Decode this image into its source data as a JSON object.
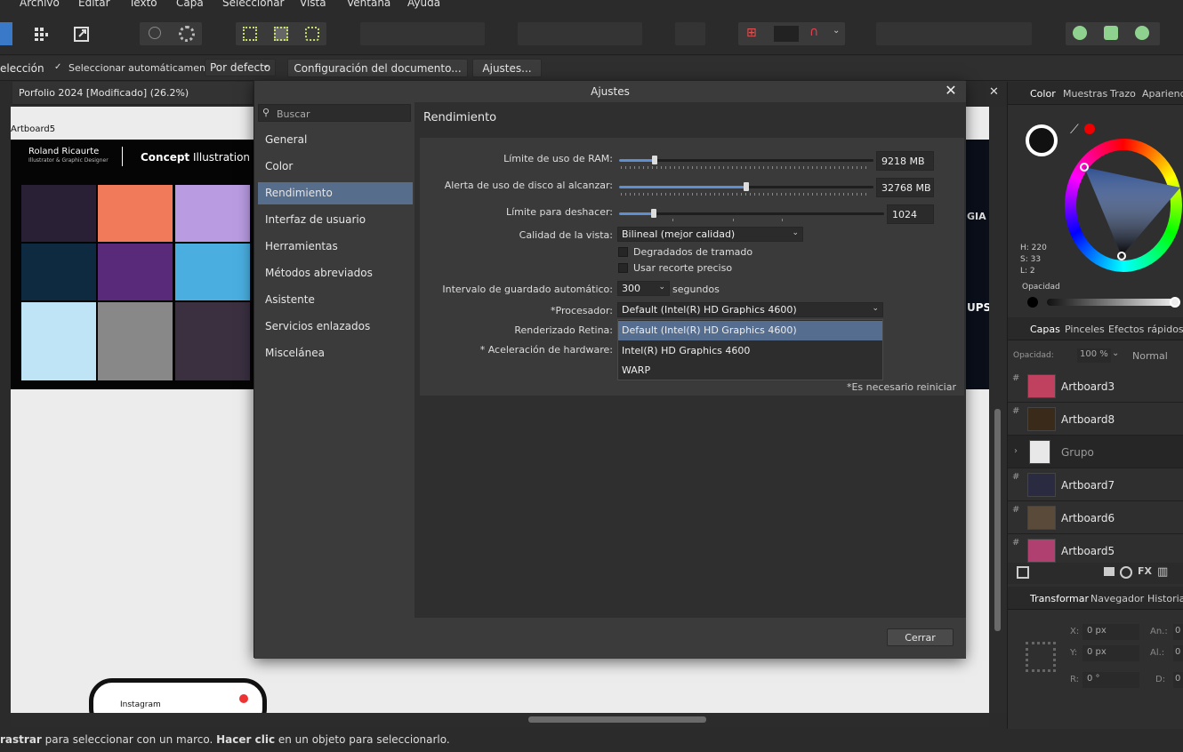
{
  "menu": [
    "Archivo",
    "Editar",
    "Texto",
    "Capa",
    "Seleccionar",
    "Vista",
    "Ventana",
    "Ayuda"
  ],
  "context": {
    "tool_label": "elección",
    "auto_select_label": "Seleccionar automáticamente:",
    "auto_select_value": "Por defecto",
    "doc_setup_button": "Configuración del documento...",
    "settings_button": "Ajustes..."
  },
  "document": {
    "tab_title": "Porfolio 2024 [Modificado] (26.2%)",
    "artboard_label": "Artboard5",
    "header_name": "Roland Ricaurte",
    "header_sub": "Illustrator & Graphic Designer",
    "header_title_bold": "Concept",
    "header_title_rest": " Illustration",
    "phone_app": "Instagram",
    "right_peek_1": "GIA",
    "right_peek_2": "UPS"
  },
  "status": {
    "bold1": "rastrar",
    "text1": " para seleccionar con un marco. ",
    "bold2": "Hacer clic",
    "text2": " en un objeto para seleccionarlo."
  },
  "dialog": {
    "title": "Ajustes",
    "search_placeholder": "Buscar",
    "nav": [
      "General",
      "Color",
      "Rendimiento",
      "Interfaz de usuario",
      "Herramientas",
      "Métodos abreviados",
      "Asistente",
      "Servicios enlazados",
      "Miscelánea"
    ],
    "selected_nav": "Rendimiento",
    "section_title": "Rendimiento",
    "ram_label": "Límite de uso de RAM:",
    "ram_value": "9218 MB",
    "ram_fraction": 0.14,
    "disk_label": "Alerta de uso de disco al alcanzar:",
    "disk_value": "32768 MB",
    "disk_fraction": 0.5,
    "undo_label": "Límite para deshacer:",
    "undo_value": "1024",
    "undo_fraction": 0.13,
    "view_quality_label": "Calidad de la vista:",
    "view_quality_value": "Bilineal (mejor calidad)",
    "dither_label": "Degradados de tramado",
    "precise_clip_label": "Usar recorte preciso",
    "autosave_label": "Intervalo de guardado automático:",
    "autosave_value": "300",
    "autosave_unit": "segundos",
    "processor_label": "*Procesador:",
    "processor_value": "Default (Intel(R) HD Graphics 4600)",
    "retina_label": "Renderizado Retina:",
    "hw_accel_label": "* Aceleración de hardware:",
    "processor_options": [
      "Default (Intel(R) HD Graphics 4600)",
      "Intel(R) HD Graphics 4600",
      "WARP"
    ],
    "restart_note": "*Es necesario reiniciar",
    "close_button": "Cerrar"
  },
  "right_panel": {
    "color_tabs": [
      "Color",
      "Muestras",
      "Trazo",
      "Aparienci"
    ],
    "hsl": {
      "h": "H: 220",
      "s": "S: 33",
      "l": "L: 2"
    },
    "opacity_label": "Opacidad",
    "layers_tabs": [
      "Capas",
      "Pinceles",
      "Efectos rápidos"
    ],
    "layer_opacity_label": "Opacidad:",
    "layer_opacity_value": "100 %",
    "blend_mode": "Normal",
    "layers": [
      "Artboard3",
      "Artboard8",
      "Grupo",
      "Artboard7",
      "Artboard6",
      "Artboard5"
    ],
    "transform_tabs": [
      "Transformar",
      "Navegador",
      "Historial"
    ],
    "transform": {
      "x_label": "X:",
      "x_value": "0 px",
      "y_label": "Y:",
      "y_value": "0 px",
      "r_label": "R:",
      "r_value": "0 °",
      "w_label": "An.:",
      "w_value": "0",
      "h_label": "Al.:",
      "h_value": "0",
      "d_label": "D:",
      "d_value": "0"
    }
  },
  "colors": {
    "accent": "#566d8c",
    "slider": "#5f8fd0",
    "bg": "#2b2b2b"
  }
}
